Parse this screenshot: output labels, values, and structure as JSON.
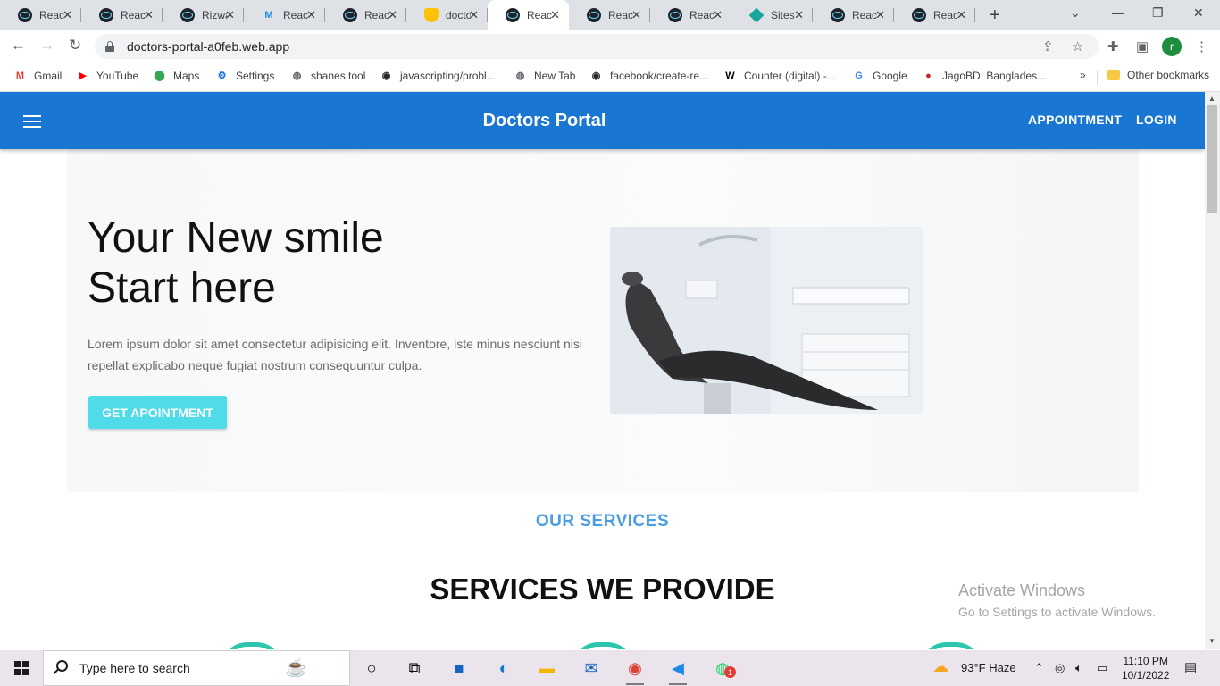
{
  "browser": {
    "tabs": [
      {
        "title": "React",
        "icon": "react-icon",
        "active": false
      },
      {
        "title": "React",
        "icon": "react-icon",
        "active": false
      },
      {
        "title": "Rizwan",
        "icon": "react-icon",
        "active": false
      },
      {
        "title": "React",
        "icon": "mui-icon",
        "active": false
      },
      {
        "title": "React",
        "icon": "react-icon",
        "active": false
      },
      {
        "title": "doctors",
        "icon": "firebase-icon",
        "active": false
      },
      {
        "title": "React",
        "icon": "react-icon",
        "active": true
      },
      {
        "title": "React",
        "icon": "react-icon",
        "active": false
      },
      {
        "title": "React",
        "icon": "react-icon",
        "active": false
      },
      {
        "title": "Sites",
        "icon": "sites-icon",
        "active": false
      },
      {
        "title": "React",
        "icon": "react-icon",
        "active": false
      },
      {
        "title": "React",
        "icon": "react-icon",
        "active": false
      }
    ],
    "url": "doctors-portal-a0feb.web.app",
    "profile_initial": "r",
    "bookmarks": [
      {
        "label": "Gmail",
        "icon": "gmail-icon",
        "color": "#ea4335"
      },
      {
        "label": "YouTube",
        "icon": "youtube-icon",
        "color": "#ff0000"
      },
      {
        "label": "Maps",
        "icon": "maps-icon",
        "color": "#34a853"
      },
      {
        "label": "Settings",
        "icon": "gear-icon",
        "color": "#1a73e8"
      },
      {
        "label": "shanes tool",
        "icon": "globe-icon",
        "color": "#5f6368"
      },
      {
        "label": "javascripting/probl...",
        "icon": "github-icon",
        "color": "#24292e"
      },
      {
        "label": "New Tab",
        "icon": "globe-icon",
        "color": "#5f6368"
      },
      {
        "label": "facebook/create-re...",
        "icon": "github-icon",
        "color": "#24292e"
      },
      {
        "label": "Counter (digital) -...",
        "icon": "wikipedia-icon",
        "color": "#000000"
      },
      {
        "label": "Google",
        "icon": "google-icon",
        "color": "#4285f4"
      },
      {
        "label": "JagoBD: Banglades...",
        "icon": "jagobd-icon",
        "color": "#c62828"
      }
    ],
    "overflow_label": "»",
    "other_bookmarks": "Other bookmarks"
  },
  "site": {
    "brand": "Doctors Portal",
    "nav": [
      "APPOINTMENT",
      "LOGIN"
    ],
    "hero": {
      "title_line1": "Your New smile",
      "title_line2": "Start here",
      "text": "Lorem ipsum dolor sit amet consectetur adipisicing elit. Inventore, iste minus nesciunt nisi repellat explicabo neque fugiat nostrum consequuntur culpa.",
      "button": "GET APOINTMENT"
    },
    "services_label": "OUR SERVICES",
    "services_title": "SERVICES WE PROVIDE",
    "accent_color": "#1976d2",
    "button_color": "#4fdbe8",
    "service_icon_color": "#2bc6ad"
  },
  "watermark": {
    "line1": "Activate Windows",
    "line2": "Go to Settings to activate Windows."
  },
  "taskbar": {
    "search_placeholder": "Type here to search",
    "weather": "93°F  Haze",
    "time": "11:10 PM",
    "date": "10/1/2022",
    "whatsapp_badge": "1"
  }
}
